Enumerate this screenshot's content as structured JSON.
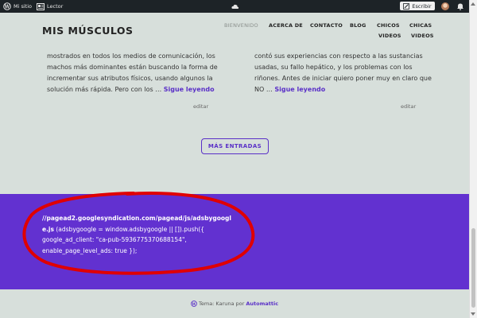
{
  "adminbar": {
    "site_label": "Mi sitio",
    "reader_label": "Lector",
    "write_label": "Escribir"
  },
  "header": {
    "site_title": "MIS MÚSCULOS",
    "nav": [
      "BIENVENIDO",
      "ACERCA DE",
      "CONTACTO",
      "BLOG",
      "CHICOS",
      "VIDEOS",
      "CHICAS",
      "VIDEOS"
    ]
  },
  "posts": [
    {
      "lines": [
        "mostrados en todos los medios de comunicación, los",
        "machos más dominantes están buscando la forma de",
        "incrementar sus atributos físicos, usando algunos la",
        "solución más rápida. Pero con los … "
      ],
      "more": "Sigue leyendo",
      "edit": "editar"
    },
    {
      "lines": [
        "contó sus experiencias con respecto a las sustancias",
        "usadas, su fallo hepático, y los problemas con los",
        "riñones. Antes de iniciar quiero poner muy en claro que",
        "NO … "
      ],
      "more": "Sigue leyendo",
      "edit": "editar"
    }
  ],
  "more_posts_label": "MÁS ENTRADAS",
  "widget": {
    "bold_line1": "//pagead2.googlesyndication.com/pagead/js/adsbygoogl",
    "bold_line2": "e.js",
    "line2_rest": " (adsbygoogle = window.adsbygoogle || []).push({",
    "line3": "google_ad_client: \"ca-pub-5936775370688154\",",
    "line4": "enable_page_level_ads: true });"
  },
  "footer": {
    "text": "Tema: Karuna por ",
    "link": "Automattic"
  },
  "colors": {
    "accent": "#5a30c7",
    "widget_bg": "#6231d0",
    "page_bg": "#d7dfdb",
    "annotation": "#e00000"
  },
  "icons": [
    "wordpress-icon",
    "reader-icon",
    "cloud-icon",
    "pencil-icon",
    "bell-icon"
  ]
}
